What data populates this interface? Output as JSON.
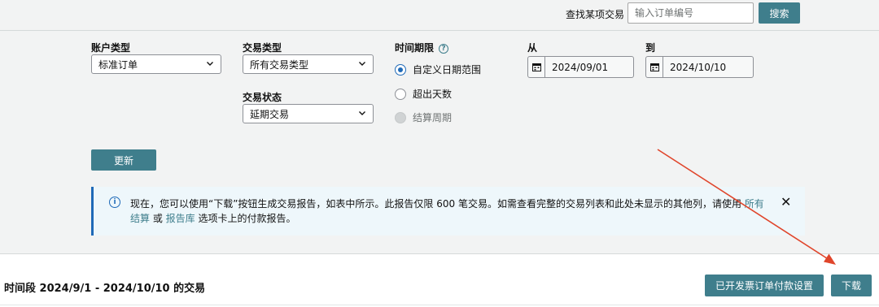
{
  "search": {
    "label": "查找某项交易",
    "placeholder": "输入订单编号",
    "button": "搜索"
  },
  "filters": {
    "account_type": {
      "label": "账户类型",
      "value": "标准订单"
    },
    "transaction_type": {
      "label": "交易类型",
      "value": "所有交易类型"
    },
    "transaction_status": {
      "label": "交易状态",
      "value": "延期交易"
    },
    "time_period": {
      "label": "时间期限",
      "options": [
        {
          "label": "自定义日期范围",
          "checked": true,
          "disabled": false
        },
        {
          "label": "超出天数",
          "checked": false,
          "disabled": false
        },
        {
          "label": "结算周期",
          "checked": false,
          "disabled": true
        }
      ]
    },
    "from": {
      "label": "从",
      "value": "2024/09/01"
    },
    "to": {
      "label": "到",
      "value": "2024/10/10"
    },
    "update_button": "更新"
  },
  "info": {
    "text_before": "现在，您可以使用“下载”按钮生成交易报告，如表中所示。此报告仅限 600 笔交易。如需查看完整的交易列表和此处未显示的其他列，请使用 ",
    "link1": "所有结算",
    "text_mid": " 或 ",
    "link2": "报告库",
    "text_after": " 选项卡上的付款报告。"
  },
  "results": {
    "title": "时间段 2024/9/1 - 2024/10/10 的交易",
    "settings_button": "已开发票订单付款设置",
    "download_button": "下载"
  },
  "colors": {
    "accent": "#3f7e8c",
    "info_border": "#1f6ab8",
    "annotation_arrow": "#e0452b"
  }
}
